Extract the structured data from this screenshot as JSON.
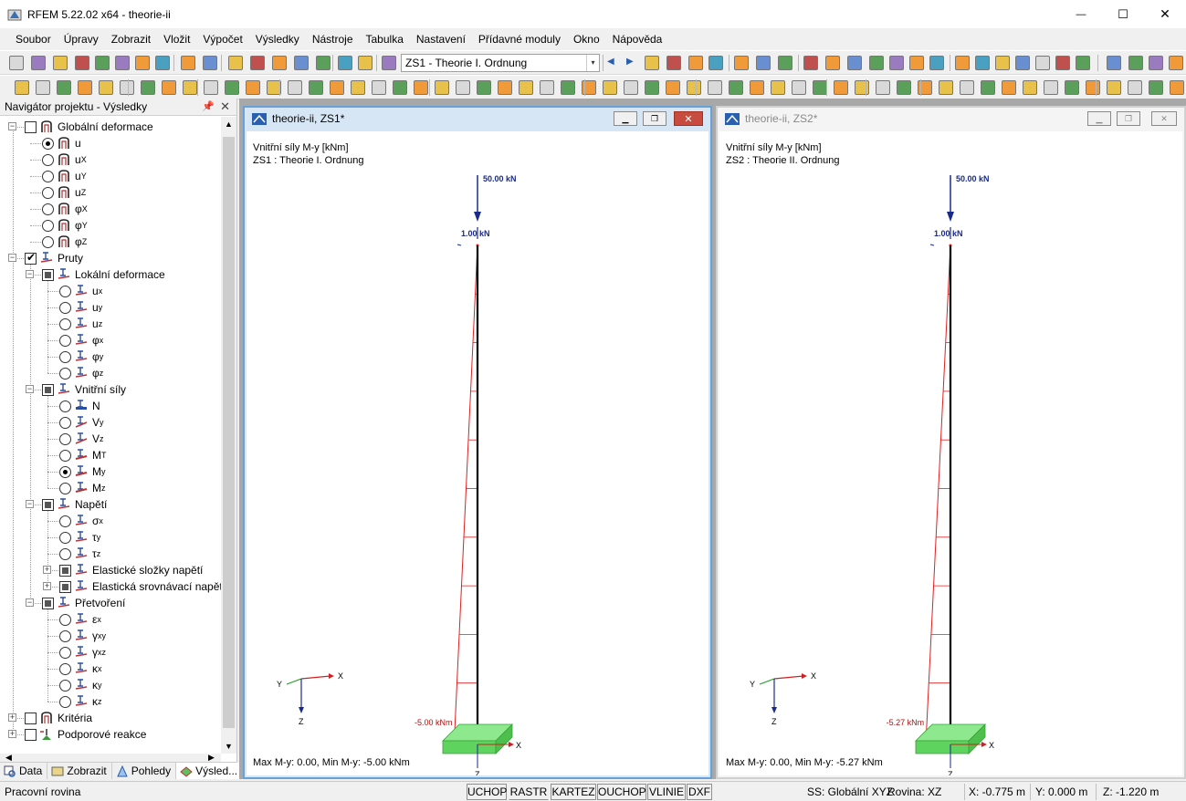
{
  "window": {
    "title": "RFEM 5.22.02 x64 - theorie-ii",
    "minimize": "—",
    "maximize": "☐",
    "close": "✕"
  },
  "menu": [
    "Soubor",
    "Úpravy",
    "Zobrazit",
    "Vložit",
    "Výpočet",
    "Výsledky",
    "Nástroje",
    "Tabulka",
    "Nastavení",
    "Přídavné moduly",
    "Okno",
    "Nápověda"
  ],
  "toolbar": {
    "load_case": "ZS1 - Theorie I. Ordnung",
    "combo_arrow": "▾",
    "prev_arrow": "◀",
    "next_arrow": "▶"
  },
  "navigator": {
    "title": "Navigátor projektu - Výsledky",
    "pin": "📌",
    "close": "✕",
    "items": [
      {
        "label": "Globální deformace",
        "sub": ""
      },
      {
        "label": "u",
        "sub": ""
      },
      {
        "label": "u",
        "sub": "X"
      },
      {
        "label": "u",
        "sub": "Y"
      },
      {
        "label": "u",
        "sub": "Z"
      },
      {
        "label": "φ",
        "sub": "X"
      },
      {
        "label": "φ",
        "sub": "Y"
      },
      {
        "label": "φ",
        "sub": "Z"
      },
      {
        "label": "Pruty",
        "sub": ""
      },
      {
        "label": "Lokální deformace",
        "sub": ""
      },
      {
        "label": "u",
        "sub": "x"
      },
      {
        "label": "u",
        "sub": "y"
      },
      {
        "label": "u",
        "sub": "z"
      },
      {
        "label": "φ",
        "sub": "x"
      },
      {
        "label": "φ",
        "sub": "y"
      },
      {
        "label": "φ",
        "sub": "z"
      },
      {
        "label": "Vnitřní síly",
        "sub": ""
      },
      {
        "label": "N",
        "sub": ""
      },
      {
        "label": "V",
        "sub": "y"
      },
      {
        "label": "V",
        "sub": "z"
      },
      {
        "label": "M",
        "sub": "T"
      },
      {
        "label": "M",
        "sub": "y"
      },
      {
        "label": "M",
        "sub": "z"
      },
      {
        "label": "Napětí",
        "sub": ""
      },
      {
        "label": "σ",
        "sub": "x"
      },
      {
        "label": "τ",
        "sub": "y"
      },
      {
        "label": "τ",
        "sub": "z"
      },
      {
        "label": "Elastické složky napětí",
        "sub": ""
      },
      {
        "label": "Elastická srovnávací napět",
        "sub": ""
      },
      {
        "label": "Přetvoření",
        "sub": ""
      },
      {
        "label": "ε",
        "sub": "x"
      },
      {
        "label": "γ",
        "sub": "xy"
      },
      {
        "label": "γ",
        "sub": "xz"
      },
      {
        "label": "κ",
        "sub": "x"
      },
      {
        "label": "κ",
        "sub": "y"
      },
      {
        "label": "κ",
        "sub": "z"
      },
      {
        "label": "Kritéria",
        "sub": ""
      },
      {
        "label": "Podporové reakce",
        "sub": ""
      }
    ],
    "tabs": [
      "Data",
      "Zobrazit",
      "Pohledy",
      "Výsled..."
    ]
  },
  "views": [
    {
      "title": "theorie-ii, ZS1*",
      "line1": "Vnitřní síly M-y [kNm]",
      "line2": "ZS1 : Theorie I. Ordnung",
      "load_top": "50.00 kN",
      "load_small": "1.00 kN",
      "moment_label": "-5.00 kNm",
      "footer": "Max M-y: 0.00, Min M-y: -5.00 kNm",
      "moment_base": 5.0
    },
    {
      "title": "theorie-ii, ZS2*",
      "line1": "Vnitřní síly M-y [kNm]",
      "line2": "ZS2 : Theorie II. Ordnung",
      "load_top": "50.00 kN",
      "load_small": "1.00 kN",
      "moment_label": "-5.27 kNm",
      "footer": "Max M-y: 0.00, Min M-y: -5.27 kNm",
      "moment_base": 5.27
    }
  ],
  "axes": {
    "x": "X",
    "y": "Y",
    "z": "Z"
  },
  "statusbar": {
    "left": "Pracovní rovina",
    "toggles": [
      "UCHOP",
      "RASTR",
      "KARTEZ",
      "OUCHOP",
      "VLINIE",
      "DXF"
    ],
    "ss": "SS: Globální XYZ",
    "plane": "Rovina: XZ",
    "x": "X:  -0.775 m",
    "y": "Y:  0.000 m",
    "z": "Z:  -1.220 m"
  },
  "colors": {
    "active_frame": "#6aa0d8",
    "moment": "#e02020",
    "member": "#000000",
    "load": "#1a2a8a",
    "support": "#5ed35e"
  }
}
